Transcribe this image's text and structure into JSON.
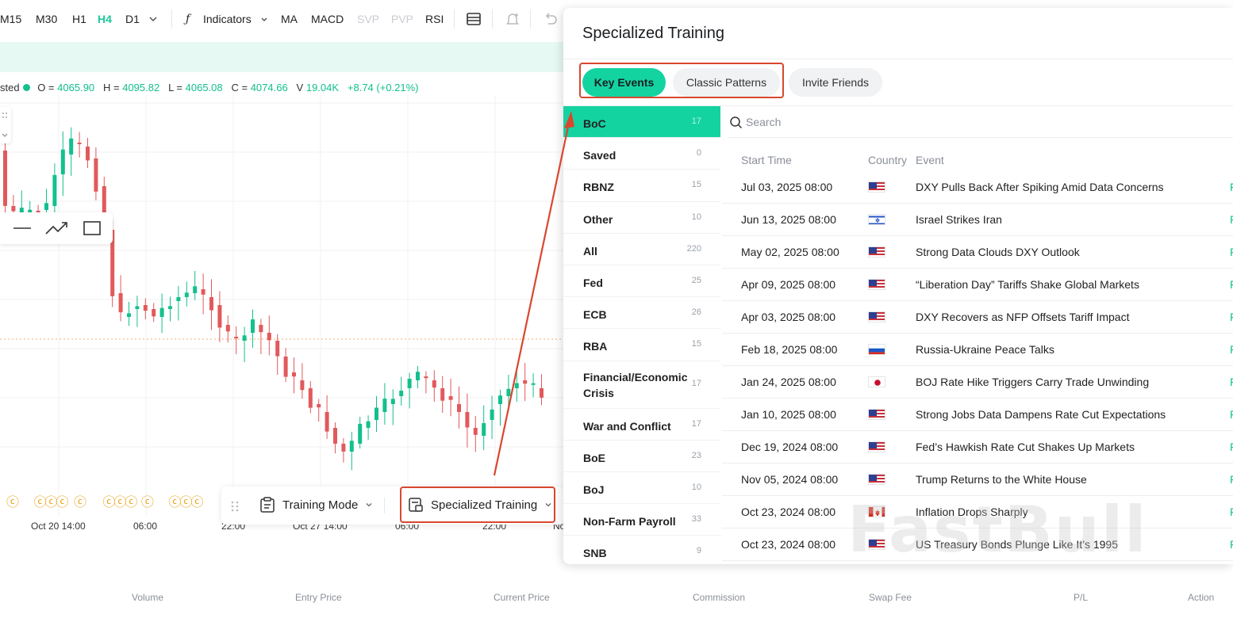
{
  "toolbar": {
    "timeframes": [
      "M15",
      "M30",
      "H1",
      "H4",
      "D1"
    ],
    "active_timeframe": "H4",
    "indicators_label": "Indicators",
    "indicators": [
      "MA",
      "MACD",
      "SVP",
      "PVP",
      "RSI"
    ],
    "disabled_indicators": [
      "SVP",
      "PVP"
    ]
  },
  "ohlc": {
    "status_suffix": "sted",
    "open_label": "O =",
    "open": "4065.90",
    "high_label": "H =",
    "high": "4095.82",
    "low_label": "L =",
    "low": "4065.08",
    "close_label": "C =",
    "close": "4074.66",
    "volume_label": "V",
    "volume": "19.04K",
    "change": "+8.74 (+0.21%)"
  },
  "chart": {
    "x_labels": [
      "Oct 20 14:00",
      "06:00",
      "22:00",
      "Oct 27 14:00",
      "06:00",
      "22:00",
      "No"
    ],
    "up_color": "#13c08d",
    "down_color": "#e2595b"
  },
  "modebar": {
    "training_mode": "Training Mode",
    "specialized_training": "Specialized Training"
  },
  "positions_header": [
    "Volume",
    "Entry Price",
    "Current Price",
    "Commission",
    "Swap Fee",
    "P/L",
    "Action"
  ],
  "panel": {
    "title": "Specialized Training",
    "tabs": [
      {
        "label": "Key Events",
        "active": true
      },
      {
        "label": "Classic Patterns",
        "active": false
      },
      {
        "label": "Invite Friends",
        "active": false
      }
    ],
    "categories": [
      {
        "label": "BoC",
        "count": "17"
      },
      {
        "label": "Saved",
        "count": "0"
      },
      {
        "label": "RBNZ",
        "count": "15"
      },
      {
        "label": "Other",
        "count": "10"
      },
      {
        "label": "All",
        "count": "220"
      },
      {
        "label": "Fed",
        "count": "25"
      },
      {
        "label": "ECB",
        "count": "26"
      },
      {
        "label": "RBA",
        "count": "15"
      },
      {
        "label": "Financial/Economic Crisis",
        "count": "17"
      },
      {
        "label": "War and Conflict",
        "count": "17"
      },
      {
        "label": "BoE",
        "count": "23"
      },
      {
        "label": "BoJ",
        "count": "10"
      },
      {
        "label": "Non-Farm Payroll",
        "count": "33"
      },
      {
        "label": "SNB",
        "count": "9"
      }
    ],
    "search_placeholder": "Search",
    "columns": {
      "start_time": "Start Time",
      "country": "Country",
      "event": "Event"
    },
    "events": [
      {
        "time": "Jul 03, 2025 08:00",
        "flag": "us-flag-icon",
        "event": "DXY Pulls Back After Spiking Amid Data Concerns"
      },
      {
        "time": "Jun 13, 2025 08:00",
        "flag": "il-flag-icon",
        "event": "Israel Strikes Iran"
      },
      {
        "time": "May 02, 2025 08:00",
        "flag": "us-flag-icon",
        "event": "Strong Data Clouds DXY Outlook"
      },
      {
        "time": "Apr 09, 2025 08:00",
        "flag": "us-flag-icon",
        "event": "“Liberation Day” Tariffs Shake Global Markets"
      },
      {
        "time": "Apr 03, 2025 08:00",
        "flag": "us-flag-icon",
        "event": "DXY Recovers as NFP Offsets Tariff Impact"
      },
      {
        "time": "Feb 18, 2025 08:00",
        "flag": "ru-flag-icon",
        "event": "Russia-Ukraine Peace Talks"
      },
      {
        "time": "Jan 24, 2025 08:00",
        "flag": "jp-flag-icon",
        "event": "BOJ Rate Hike Triggers Carry Trade Unwinding"
      },
      {
        "time": "Jan 10, 2025 08:00",
        "flag": "us-flag-icon",
        "event": "Strong Jobs Data Dampens Rate Cut Expectations"
      },
      {
        "time": "Dec 19, 2024 08:00",
        "flag": "us-flag-icon",
        "event": "Fed’s Hawkish Rate Cut Shakes Up Markets"
      },
      {
        "time": "Nov 05, 2024 08:00",
        "flag": "us-flag-icon",
        "event": "Trump Returns to the White House"
      },
      {
        "time": "Oct 23, 2024 08:00",
        "flag": "ca-flag-icon",
        "event": "Inflation Drops Sharply"
      },
      {
        "time": "Oct 23, 2024 08:00",
        "flag": "us-flag-icon",
        "event": "US Treasury Bonds Plunge Like It’s 1995"
      }
    ],
    "row_action": "F"
  },
  "watermark": "FastBull",
  "colors": {
    "accent": "#13d3a1",
    "highlight": "#d9472f",
    "up": "#13c08d",
    "down": "#e2595b"
  }
}
